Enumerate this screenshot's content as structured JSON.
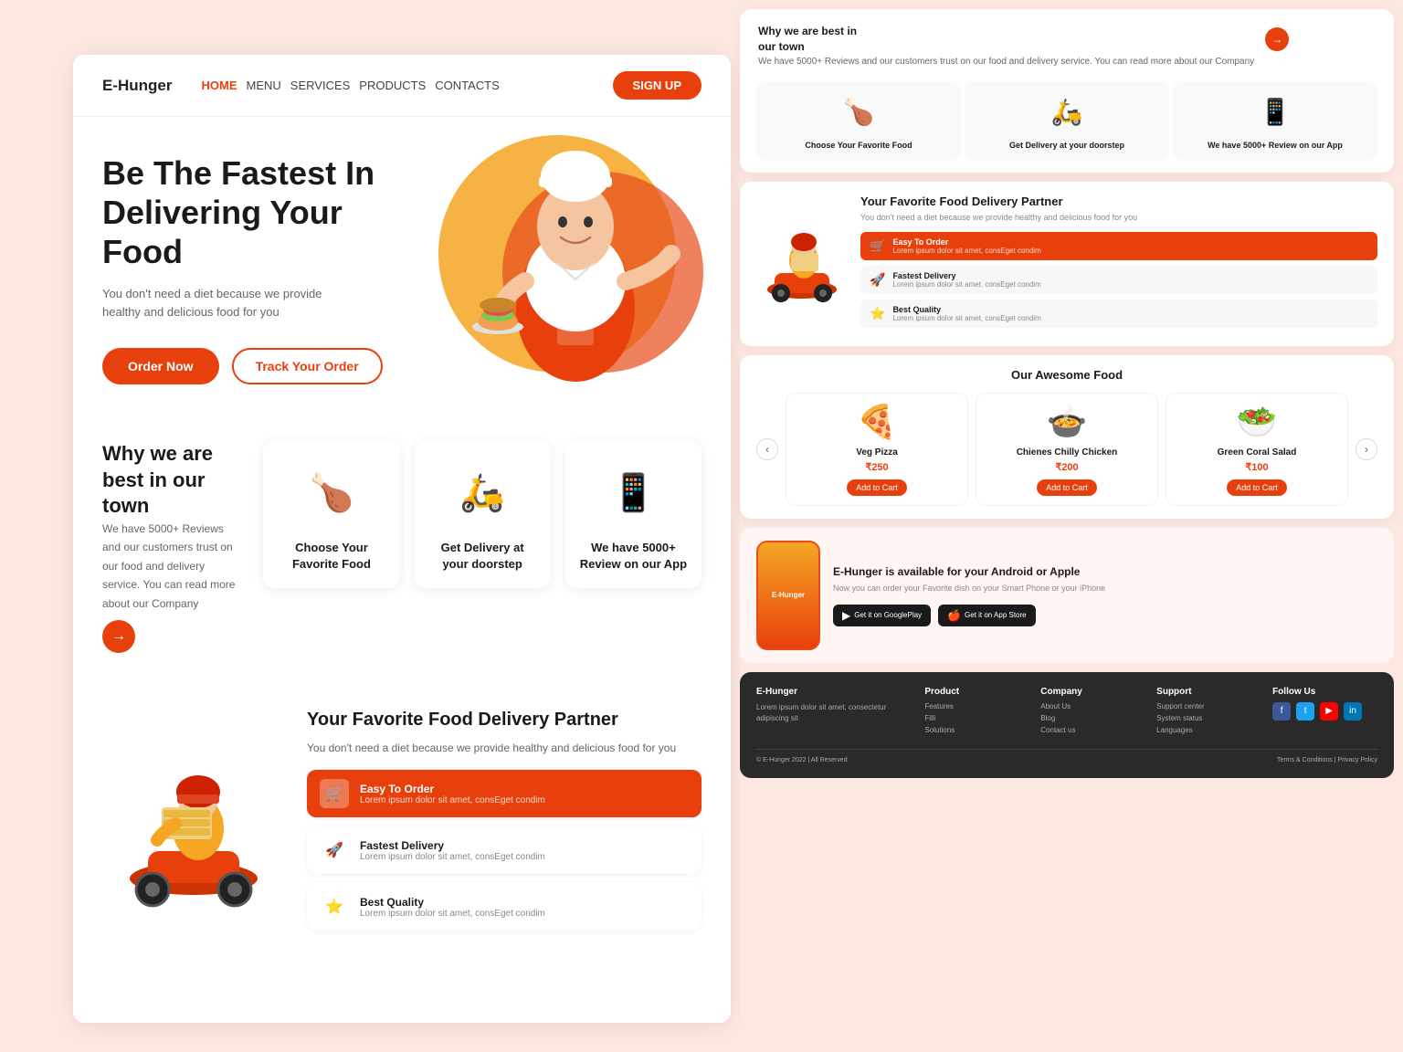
{
  "brand": {
    "name": "E-Hunger"
  },
  "nav": {
    "links": [
      {
        "label": "HOME",
        "active": true
      },
      {
        "label": "MENU",
        "active": false
      },
      {
        "label": "SERVICES",
        "active": false
      },
      {
        "label": "PRODUCTS",
        "active": false
      },
      {
        "label": "CONTACTS",
        "active": false
      }
    ],
    "signup_label": "SIGN UP"
  },
  "hero": {
    "title": "Be The Fastest In Delivering Your Food",
    "subtitle": "You don't need a diet because we provide healthy and delicious food for you",
    "btn_order": "Order Now",
    "btn_track": "Track Your Order"
  },
  "why": {
    "title": "Why we are best in our town",
    "desc": "We have 5000+ Reviews and our customers trust on our food and delivery service. You can read more about our Company",
    "cards": [
      {
        "label": "Choose Your Favorite Food",
        "emoji": "🍗"
      },
      {
        "label": "Get Delivery at your doorstep",
        "emoji": "🛵"
      },
      {
        "label": "We have 5000+ Review on our App",
        "emoji": "📱"
      }
    ]
  },
  "delivery": {
    "title": "Your Favorite Food Delivery Partner",
    "desc": "You don't need a diet because we provide healthy and delicious food for you",
    "features": [
      {
        "label": "Easy To Order",
        "desc": "Lorem ipsum dolor sit amet, consEget condim",
        "active": true,
        "emoji": "🛒"
      },
      {
        "label": "Fastest Delivery",
        "desc": "Lorem ipsum dolor sit amet, consEget condim",
        "active": false,
        "emoji": "🚀"
      },
      {
        "label": "Best Quality",
        "desc": "Lorem ipsum dolor sit amet, consEget condim",
        "active": false,
        "emoji": "⭐"
      }
    ]
  },
  "food_section": {
    "title": "Our Awesome Food",
    "items": [
      {
        "name": "Veg Pizza",
        "price": "₹250",
        "emoji": "🍕",
        "btn": "Add to Cart"
      },
      {
        "name": "Chienes Chilly Chicken",
        "price": "₹200",
        "emoji": "🍲",
        "btn": "Add to Cart"
      },
      {
        "name": "Green Coral Salad",
        "price": "₹100",
        "emoji": "🥗",
        "btn": "Add to Cart"
      }
    ]
  },
  "app_section": {
    "title": "E-Hunger is available for your Android or Apple",
    "desc": "Now you can order your Favorite dish on your Smart Phone or your iPhone",
    "phone_brand": "E-Hunger",
    "btn_google": "Get it on\nGooglePlay",
    "btn_apple": "Get it on\nApp Store"
  },
  "footer": {
    "brand": "E-Hunger",
    "brand_desc": "Lorem ipsum dolor sit amet, consectetur adipiscing sit",
    "columns": [
      {
        "title": "Product",
        "items": [
          "Features",
          "Filli",
          "Solutions"
        ]
      },
      {
        "title": "Company",
        "items": [
          "About Us",
          "Blog",
          "Contact us"
        ]
      },
      {
        "title": "Support",
        "items": [
          "Support center",
          "System status",
          "Languages"
        ]
      },
      {
        "title": "Follow Us",
        "socials": [
          "f",
          "t",
          "▶",
          "in"
        ]
      }
    ],
    "copyright": "© E-Hunger 2022 | All Reserved",
    "links": "Terms & Conditions | Privacy Policy"
  }
}
